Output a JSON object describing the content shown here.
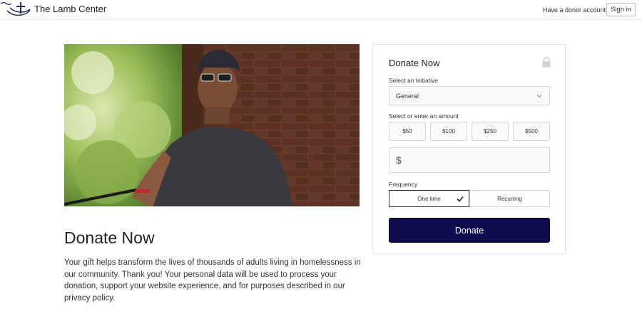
{
  "header": {
    "org_name": "The Lamb Center",
    "donor_question": "Have a donor account?",
    "sign_in_label": "Sign in"
  },
  "main": {
    "title": "Donate Now",
    "description": "Your gift helps transform the lives of thousands of adults living in homelessness in our community. Thank you! Your personal data will be used to process your donation, support your website experience, and for purposes described in our privacy policy."
  },
  "donation_form": {
    "title": "Donate Now",
    "initiative_label": "Select an Initiative",
    "initiative_value": "General",
    "amount_label": "Select or enter an amount",
    "amounts": [
      "$50",
      "$100",
      "$250",
      "$500"
    ],
    "currency_symbol": "$",
    "frequency_label": "Frequency",
    "frequency_options": [
      "One time",
      "Recurring"
    ],
    "frequency_selected": "One time",
    "donate_label": "Donate"
  },
  "colors": {
    "donate_button": "#0e0c4f",
    "lock_icon": "#d0d0d0"
  }
}
